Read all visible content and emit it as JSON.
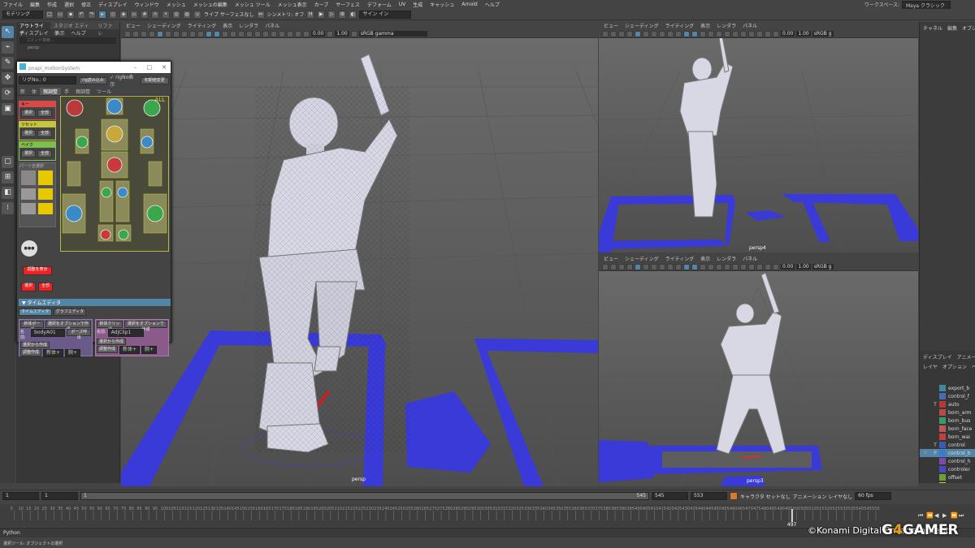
{
  "menubar": {
    "items": [
      "ファイル",
      "編集",
      "作成",
      "選択",
      "修正",
      "ディスプレイ",
      "ウィンドウ",
      "メッシュ",
      "メッシュの編集",
      "メッシュ ツール",
      "メッシュ表示",
      "カーブ",
      "サーフェス",
      "デフォーム",
      "UV",
      "生成",
      "キャッシュ",
      "Arnold",
      "ヘルプ"
    ],
    "workspace_label": "ワークスペース:",
    "workspace_value": "Maya クラシック*"
  },
  "statusline": {
    "menuset": "モデリング",
    "live_label": "ライブ サーフェスなし",
    "symmetry_label": "シンメトリ: オフ",
    "signin_label": "サイン イン"
  },
  "outliner": {
    "tabs": [
      "アウトライナ",
      "スタジオ エディタ",
      "リファレ"
    ],
    "menus": [
      "ディスプレイ",
      "表示",
      "ヘルプ"
    ],
    "search_placeholder": "コマンド検索...",
    "item": "persp"
  },
  "tool_window": {
    "title": "pnapi_motionSystem",
    "rig_select": "リグNo.: 0",
    "rig_load": "rig読み込み",
    "rig_no_display": "rigNo表示",
    "initial_state": "初期値変更",
    "tabs": [
      "新",
      "体",
      "親調整",
      "手",
      "親調整",
      "ツール"
    ],
    "groups": [
      {
        "head": "キー",
        "color": "#d84a4a",
        "buttons": [
          "選択",
          "全部"
        ]
      },
      {
        "head": "リセット",
        "color": "#c6c63c",
        "buttons": [
          "選択",
          "全部"
        ]
      },
      {
        "head": "ベイク",
        "color": "#7ec04a",
        "buttons": [
          "選択",
          "全部"
        ]
      }
    ],
    "parts_label": "パーツ全選択",
    "all_label": "ALL",
    "adjust_label": "調整を表示",
    "red_buttons": [
      "選択",
      "全部"
    ],
    "timeeditor_section": "タイムエディタ",
    "te_tabs": [
      "タイムエディタ",
      "グラフエディタ"
    ],
    "left_box": {
      "head_btn": "新体ポーズ",
      "create_opt": "選択をオプションで作成",
      "name_label": "名前:",
      "name_value": "bodyA01",
      "pose_call": "ポーズ呼出",
      "from_sel": "選択から作成",
      "adjust": "調整作成",
      "body_plus": "新体+",
      "hand_plus": "腕+"
    },
    "right_box": {
      "head_btn": "新体クリップ",
      "create_opt": "選択をオプションで作成",
      "name_label": "名前:",
      "name_value": "AdjClip1",
      "from_sel": "選択から作成",
      "adjust": "調整作成",
      "body_plus": "新体+",
      "hand_plus": "腕+"
    }
  },
  "viewports": {
    "menus": [
      "ビュー",
      "シェーディング",
      "ライティング",
      "表示",
      "レンダラ",
      "パネル"
    ],
    "field1": "0.00",
    "field2": "1.00",
    "colorspace": "sRGB gamma",
    "colorspace_short": "sRGB g",
    "main_cam": "persp",
    "top_cam": "persp4",
    "bottom_cam": "persp3"
  },
  "right_panel": {
    "tabs": [
      "チャネル",
      "編集",
      "オブジェ"
    ],
    "layer_tabs": [
      "ディスプレイ",
      "アニメーション"
    ],
    "layer_menus": [
      "レイヤ",
      "オプション",
      "ヘルプ"
    ],
    "layers": [
      {
        "v": "",
        "p": "",
        "name": "export_b",
        "color": "#3c8a9a"
      },
      {
        "v": "",
        "p": "",
        "name": "control_f",
        "color": "#4a6ab0"
      },
      {
        "v": "",
        "p": "T",
        "name": "auto",
        "color": "#b03a3a"
      },
      {
        "v": "",
        "p": "",
        "name": "born_arm",
        "color": "#b84a4a"
      },
      {
        "v": "",
        "p": "",
        "name": "born_bus",
        "color": "#3a9a6a"
      },
      {
        "v": "",
        "p": "",
        "name": "born_face",
        "color": "#b85a5a"
      },
      {
        "v": "",
        "p": "",
        "name": "born_wai",
        "color": "#c04040"
      },
      {
        "v": "",
        "p": "T",
        "name": "control",
        "color": "#3a5ab0"
      },
      {
        "v": "V",
        "p": "P",
        "name": "control_b",
        "color": "#3a7ad0"
      },
      {
        "v": "",
        "p": "",
        "name": "control_h",
        "color": "#7a4ab0"
      },
      {
        "v": "",
        "p": "",
        "name": "controler",
        "color": "#4a4ac0"
      },
      {
        "v": "",
        "p": "",
        "name": "offset",
        "color": "#6aa03a"
      },
      {
        "v": "",
        "p": "",
        "name": "yellowwit",
        "color": "#c8c83a"
      }
    ]
  },
  "timeline": {
    "start": "1",
    "start2": "1",
    "range_start": "1",
    "range_end": "545",
    "end1": "545",
    "end2": "553",
    "char_set": "キャラクタ セットなし",
    "anim_layer": "アニメーション レイヤなし",
    "fps": "60 fps",
    "current_frame": "497",
    "ticks": [
      "5",
      "10",
      "15",
      "20",
      "25",
      "30",
      "35",
      "40",
      "45",
      "50",
      "55",
      "60",
      "65",
      "70",
      "75",
      "80",
      "85",
      "90",
      "95",
      "100",
      "105",
      "110",
      "115",
      "120",
      "125",
      "130",
      "135",
      "140",
      "145",
      "150",
      "155",
      "160",
      "165",
      "170",
      "175",
      "180",
      "185",
      "190",
      "195",
      "200",
      "205",
      "210",
      "215",
      "220",
      "225",
      "230",
      "235",
      "240",
      "245",
      "250",
      "255",
      "260",
      "265",
      "270",
      "275",
      "280",
      "285",
      "290",
      "295",
      "300",
      "305",
      "310",
      "315",
      "320",
      "325",
      "330",
      "335",
      "340",
      "345",
      "350",
      "355",
      "360",
      "365",
      "370",
      "375",
      "380",
      "385",
      "390",
      "395",
      "400",
      "405",
      "410",
      "415",
      "420",
      "425",
      "430",
      "435",
      "440",
      "445",
      "450",
      "455",
      "460",
      "465",
      "470",
      "475",
      "480",
      "485",
      "490",
      "495",
      "500",
      "505",
      "510",
      "515",
      "520",
      "525",
      "530",
      "535",
      "540",
      "545",
      "550"
    ]
  },
  "cmdline": {
    "label": "Python"
  },
  "helpline": {
    "text": "選択ツール: オブジェクトの選択"
  },
  "watermark": {
    "copyright": "©Konami Digital Entertainment",
    "brand_a": "G",
    "brand_4": "4",
    "brand_b": "GAMER"
  }
}
